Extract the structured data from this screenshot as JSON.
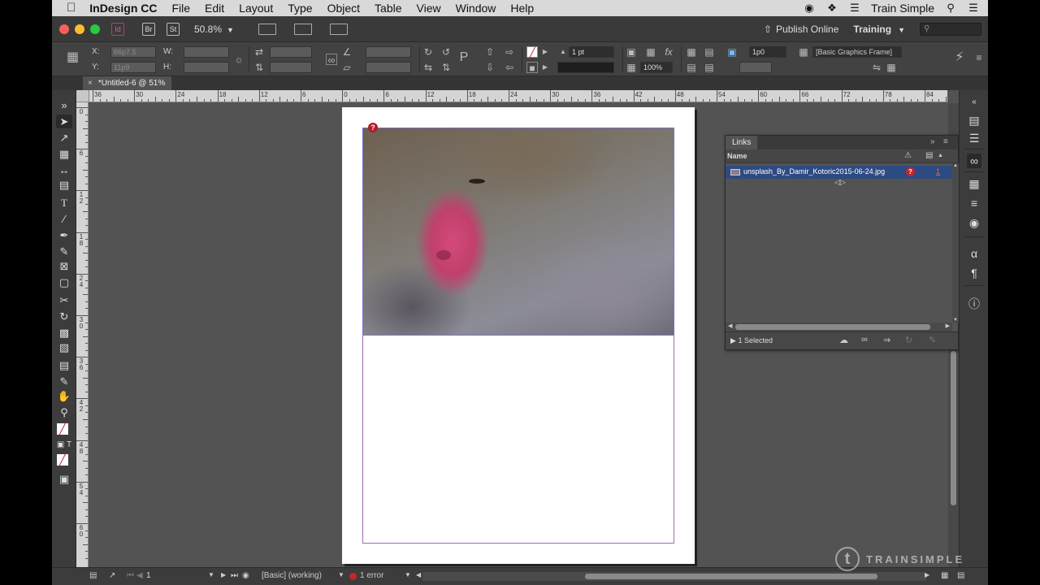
{
  "menubar": {
    "apple": "",
    "app_name": "InDesign CC",
    "items": [
      "File",
      "Edit",
      "Layout",
      "Type",
      "Object",
      "Table",
      "View",
      "Window",
      "Help"
    ],
    "user": "Train Simple"
  },
  "appbar": {
    "bridge_label": "Br",
    "stock_label": "St",
    "zoom": "50.8%",
    "publish_label": "Publish Online",
    "workspace": "Training"
  },
  "control": {
    "x_label": "X:",
    "y_label": "Y:",
    "w_label": "W:",
    "h_label": "H:",
    "x_value": "66p7.5",
    "y_value": "11p9",
    "stroke_weight": "1 pt",
    "zoom_percent": "100%",
    "offset_value": "1p0",
    "object_style": "[Basic Graphics Frame]"
  },
  "document": {
    "tab_title": "*Untitled-6 @ 51%",
    "close_glyph": "×"
  },
  "rulers": {
    "h_labels": [
      "36",
      "30",
      "24",
      "18",
      "12",
      "6",
      "0",
      "6",
      "12",
      "18",
      "24",
      "30",
      "36",
      "42",
      "48",
      "54",
      "60",
      "66",
      "72",
      "78",
      "84"
    ],
    "v_labels": [
      "0",
      "6",
      "1 2",
      "1 8",
      "2 4",
      "3 0",
      "3 6",
      "4 2",
      "4 8",
      "5 4",
      "6 0"
    ]
  },
  "links_panel": {
    "title": "Links",
    "column_name": "Name",
    "link_file": "unsplash_By_Damir_Kotoric2015-06-24.jpg",
    "link_page": "1",
    "selected_count": "1 Selected",
    "missing_glyph": "?"
  },
  "status": {
    "page_number": "1",
    "preflight_profile": "[Basic] (working)",
    "error_count": "1 error"
  },
  "watermark": {
    "text": "TRAINSIMPLE"
  },
  "colors": {
    "accent_selection": "#2e4a82",
    "error_red": "#c1272d",
    "frame_margin": "#a06ab4"
  }
}
